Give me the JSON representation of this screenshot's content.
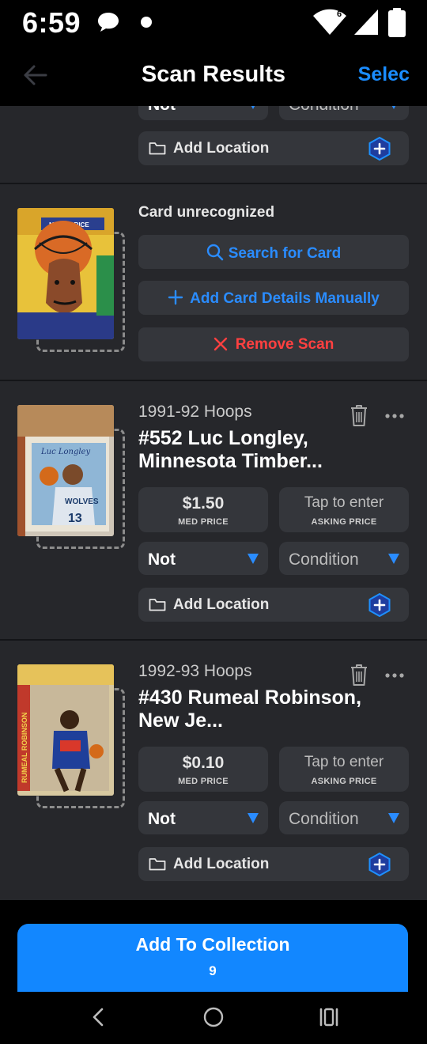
{
  "status_bar": {
    "time": "6:59",
    "wifi_badge": "6"
  },
  "header": {
    "title": "Scan Results",
    "select_label": "Selec"
  },
  "top_partial": {
    "condition_label": "Not",
    "condition_placeholder": "Condition",
    "location_label": "Add Location"
  },
  "unrecognized": {
    "status_text": "Card unrecognized",
    "search_label": "Search for Card",
    "add_manual_label": "Add Card Details Manually",
    "remove_label": "Remove Scan",
    "thumb_text": "MARK PRICE"
  },
  "cards": [
    {
      "set": "1991-92 Hoops",
      "name": "#552 Luc Longley, Minnesota Timber...",
      "med_price": "$1.50",
      "med_price_label": "MED PRICE",
      "asking_placeholder": "Tap to enter",
      "asking_label": "ASKING PRICE",
      "condition_value": "Not",
      "condition_placeholder": "Condition",
      "location_label": "Add Location",
      "thumb_text": "Luc Longley"
    },
    {
      "set": "1992-93 Hoops",
      "name": "#430 Rumeal Robinson, New Je...",
      "med_price": "$0.10",
      "med_price_label": "MED PRICE",
      "asking_placeholder": "Tap to enter",
      "asking_label": "ASKING PRICE",
      "condition_value": "Not",
      "condition_placeholder": "Condition",
      "location_label": "Add Location",
      "thumb_text": "RUMEAL ROBINSON"
    }
  ],
  "bottom": {
    "add_label": "Add To Collection",
    "count": "9"
  },
  "colors": {
    "accent": "#1287ff",
    "danger": "#ff4040",
    "link": "#1a8cff"
  }
}
